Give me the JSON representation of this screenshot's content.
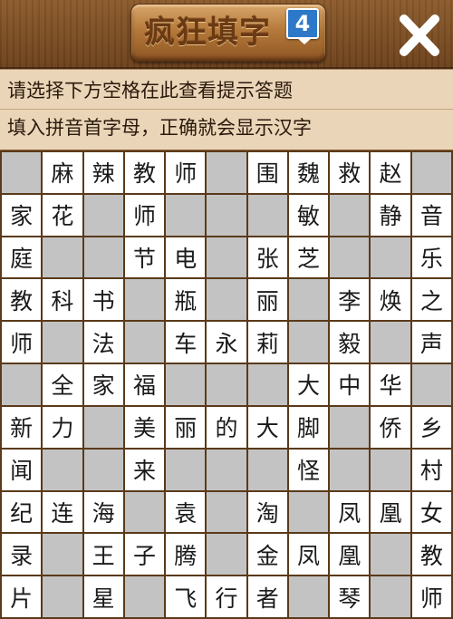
{
  "header": {
    "title": "疯狂填字",
    "level": "4"
  },
  "hint": {
    "line1": "请选择下方空格在此查看提示答题",
    "line2": "填入拼音首字母，正确就会显示汉字"
  },
  "colors": {
    "header_wood": "#7a4c22",
    "hint_bg": "#ead5b8",
    "cell_filled": "#ffffff",
    "cell_blank": "#c3c3c3",
    "grid_line": "#5a3a1a",
    "badge_blue": "#2d78c8"
  },
  "grid": [
    [
      "",
      "麻",
      "辣",
      "教",
      "师",
      "",
      "围",
      "魏",
      "救",
      "赵",
      ""
    ],
    [
      "家",
      "花",
      "",
      "师",
      "",
      "",
      "",
      "敏",
      "",
      "静",
      "音"
    ],
    [
      "庭",
      "",
      "",
      "节",
      "电",
      "",
      "张",
      "芝",
      "",
      "",
      "乐"
    ],
    [
      "教",
      "科",
      "书",
      "",
      "瓶",
      "",
      "丽",
      "",
      "李",
      "焕",
      "之"
    ],
    [
      "师",
      "",
      "法",
      "",
      "车",
      "永",
      "莉",
      "",
      "毅",
      "",
      "声"
    ],
    [
      "",
      "全",
      "家",
      "福",
      "",
      "",
      "",
      "大",
      "中",
      "华",
      ""
    ],
    [
      "新",
      "力",
      "",
      "美",
      "丽",
      "的",
      "大",
      "脚",
      "",
      "侨",
      "乡"
    ],
    [
      "闻",
      "",
      "",
      "来",
      "",
      "",
      "",
      "怪",
      "",
      "",
      "村"
    ],
    [
      "纪",
      "连",
      "海",
      "",
      "袁",
      "",
      "淘",
      "",
      "凤",
      "凰",
      "女"
    ],
    [
      "录",
      "",
      "王",
      "子",
      "腾",
      "",
      "金",
      "凤",
      "凰",
      "",
      "教"
    ],
    [
      "片",
      "",
      "星",
      "",
      "飞",
      "行",
      "者",
      "",
      "琴",
      "",
      "师"
    ]
  ]
}
